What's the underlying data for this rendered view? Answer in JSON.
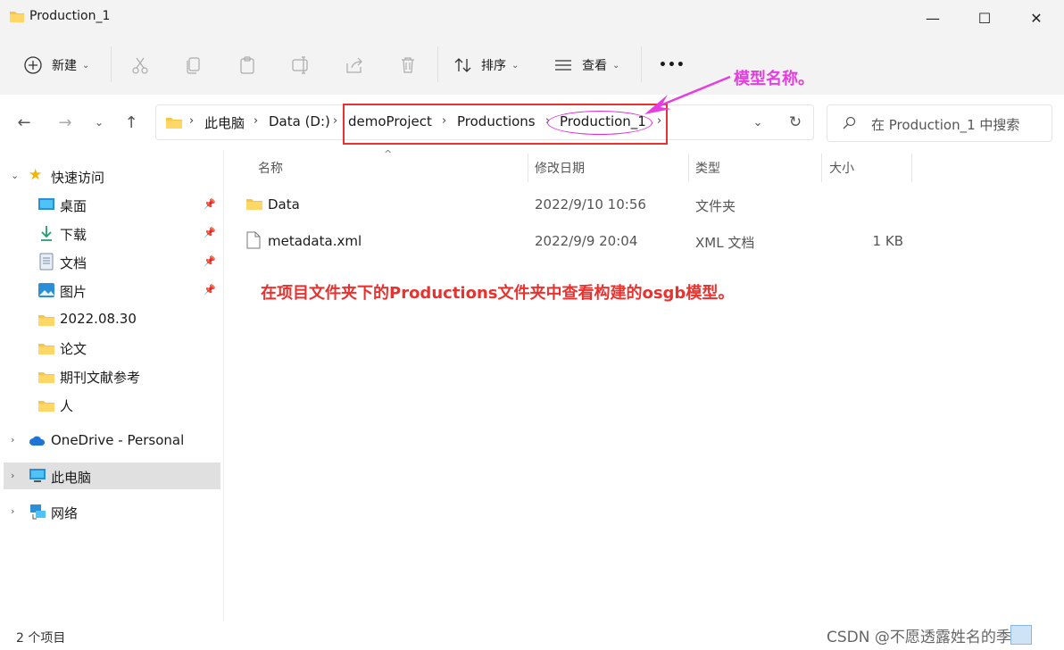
{
  "window": {
    "title": "Production_1",
    "minimize": "—",
    "maximize": "☐",
    "close": "✕"
  },
  "toolbar": {
    "new_label": "新建",
    "sort_label": "排序",
    "view_label": "查看",
    "more_label": "•••"
  },
  "address": {
    "crumbs": [
      "此电脑",
      "Data (D:)",
      "demoProject",
      "Productions",
      "Production_1"
    ],
    "search_placeholder": "在 Production_1 中搜索"
  },
  "sidebar": {
    "quick_access": "快速访问",
    "items": [
      {
        "label": "桌面",
        "pinned": true,
        "icon": "desktop-icon"
      },
      {
        "label": "下载",
        "pinned": true,
        "icon": "download-icon"
      },
      {
        "label": "文档",
        "pinned": true,
        "icon": "document-icon"
      },
      {
        "label": "图片",
        "pinned": true,
        "icon": "picture-icon"
      },
      {
        "label": "2022.08.30",
        "pinned": false,
        "icon": "folder-icon"
      },
      {
        "label": "论文",
        "pinned": false,
        "icon": "folder-icon"
      },
      {
        "label": "期刊文献参考",
        "pinned": false,
        "icon": "folder-icon"
      },
      {
        "label": "人",
        "pinned": false,
        "icon": "folder-icon"
      }
    ],
    "onedrive": "OneDrive - Personal",
    "this_pc": "此电脑",
    "network": "网络"
  },
  "columns": {
    "name": "名称",
    "modified": "修改日期",
    "type": "类型",
    "size": "大小"
  },
  "files": [
    {
      "name": "Data",
      "modified": "2022/9/10 10:56",
      "type": "文件夹",
      "size": "",
      "icon": "folder-icon"
    },
    {
      "name": "metadata.xml",
      "modified": "2022/9/9 20:04",
      "type": "XML 文档",
      "size": "1 KB",
      "icon": "file-icon"
    }
  ],
  "annotations": {
    "model_name": "模型名称。",
    "note": "在项目文件夹下的Productions文件夹中查看构建的osgb模型。"
  },
  "status": {
    "item_count": "2 个项目",
    "watermark": "CSDN @不愿透露姓名的季节"
  },
  "colors": {
    "annotation_red": "#e8322f",
    "annotation_magenta": "#e63de0",
    "folder_yellow": "#f8c445",
    "selection_gray": "#e0e0e0"
  }
}
